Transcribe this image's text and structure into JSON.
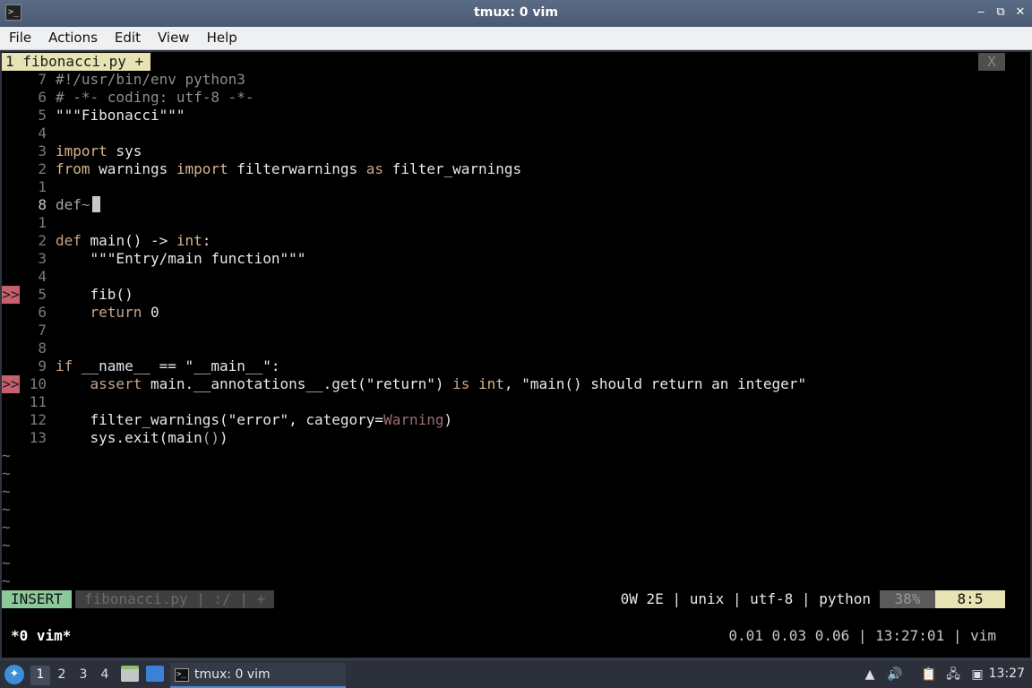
{
  "window": {
    "title": "tmux: 0 vim",
    "icon_text": ">_",
    "controls": [
      "‒",
      "⧉",
      "✕"
    ]
  },
  "menu": [
    "File",
    "Actions",
    "Edit",
    "View",
    "Help"
  ],
  "vim": {
    "tab_label": "1 fibonacci.py  +",
    "close_label": "X",
    "lines": [
      {
        "num": "7",
        "sign": "",
        "tokens": [
          [
            "cm",
            "#!/usr/bin/env python3"
          ]
        ]
      },
      {
        "num": "6",
        "sign": "",
        "tokens": [
          [
            "cm",
            "# -*- coding: utf-8 -*-"
          ]
        ]
      },
      {
        "num": "5",
        "sign": "",
        "tokens": [
          [
            "str",
            "\"\"\"Fibonacci\"\"\""
          ]
        ]
      },
      {
        "num": "4",
        "sign": "",
        "tokens": []
      },
      {
        "num": "3",
        "sign": "",
        "tokens": [
          [
            "kw",
            "import"
          ],
          [
            "fn",
            " sys"
          ]
        ]
      },
      {
        "num": "2",
        "sign": "",
        "tokens": [
          [
            "kw",
            "from"
          ],
          [
            "fn",
            " warnings "
          ],
          [
            "kw",
            "import"
          ],
          [
            "fn",
            " filterwarnings "
          ],
          [
            "kw2",
            "as"
          ],
          [
            "fn",
            " filter_warnings"
          ]
        ]
      },
      {
        "num": "1",
        "sign": "",
        "tokens": []
      },
      {
        "num": "8",
        "sign": "",
        "current": true,
        "tokens": [
          [
            "dim",
            "def"
          ],
          [
            "cm",
            "~"
          ]
        ]
      },
      {
        "num": "1",
        "sign": "",
        "tokens": []
      },
      {
        "num": "2",
        "sign": "",
        "tokens": [
          [
            "kw2",
            "def"
          ],
          [
            "fn",
            " main() -> "
          ],
          [
            "kw",
            "int"
          ],
          [
            "fn",
            ":"
          ]
        ]
      },
      {
        "num": "3",
        "sign": "",
        "tokens": [
          [
            "str",
            "    \"\"\"Entry/main function\"\"\""
          ]
        ]
      },
      {
        "num": "4",
        "sign": "",
        "tokens": []
      },
      {
        "num": "5",
        "sign": ">>",
        "tokens": [
          [
            "fn",
            "    fib()"
          ]
        ]
      },
      {
        "num": "6",
        "sign": "",
        "tokens": [
          [
            "kw2",
            "    return"
          ],
          [
            "fn",
            " 0"
          ]
        ]
      },
      {
        "num": "7",
        "sign": "",
        "tokens": []
      },
      {
        "num": "8",
        "sign": "",
        "tokens": []
      },
      {
        "num": "9",
        "sign": "",
        "tokens": [
          [
            "kw2",
            "if"
          ],
          [
            "fn",
            " __name__ == "
          ],
          [
            "str",
            "\"__main__\""
          ],
          [
            "fn",
            ":"
          ]
        ]
      },
      {
        "num": "10",
        "sign": ">>",
        "tokens": [
          [
            "kw2",
            "    assert"
          ],
          [
            "fn",
            " main.__annotations__.get("
          ],
          [
            "str",
            "\"return\""
          ],
          [
            "fn",
            ") "
          ],
          [
            "kw2",
            "is"
          ],
          [
            "fn",
            " "
          ],
          [
            "kw",
            "int"
          ],
          [
            "fn",
            ", "
          ],
          [
            "str",
            "\"main() should return an integer\""
          ]
        ]
      },
      {
        "num": "11",
        "sign": "",
        "tokens": []
      },
      {
        "num": "12",
        "sign": "",
        "tokens": [
          [
            "fn",
            "    filter_warnings("
          ],
          [
            "str",
            "\"error\""
          ],
          [
            "fn",
            ", category="
          ],
          [
            "warn",
            "Warning"
          ],
          [
            "fn",
            ")"
          ]
        ]
      },
      {
        "num": "13",
        "sign": "",
        "tokens": [
          [
            "fn",
            "    sys.exit(main"
          ],
          [
            "dim",
            "()"
          ],
          [
            "fn",
            ")"
          ]
        ]
      }
    ],
    "tilde_count": 8,
    "tilde_char": "~",
    "statusline": {
      "mode": "INSERT",
      "fileinfo": "fibonacci.py  |  :/  |  +",
      "right": "0W 2E  |  unix  |  utf-8  |  python",
      "percent": "38%",
      "position": "8:5"
    }
  },
  "tmux": {
    "window": "*0 vim*",
    "stats": "0.01 0.03 0.06 | 13:27:01 | vim"
  },
  "taskbar": {
    "workspaces": [
      "1",
      "2",
      "3",
      "4"
    ],
    "task_label": "tmux: 0 vim",
    "clock": "13:27"
  }
}
